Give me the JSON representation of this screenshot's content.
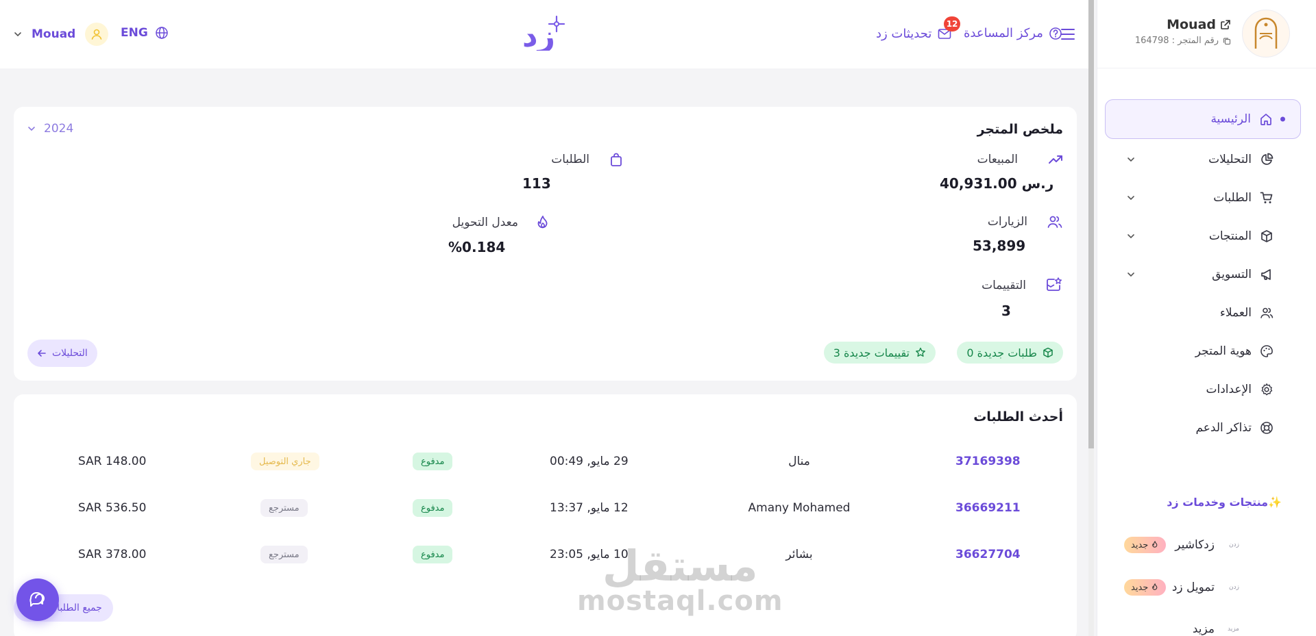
{
  "colors": {
    "accent": "#6b4bd9",
    "success": "#16864a",
    "danger": "#f04438",
    "warning": "#e5b94d"
  },
  "topbar": {
    "user_name": "Mouad",
    "language": "ENG",
    "brand_logo_text": "زد",
    "help_label": "مركز المساعدة",
    "updates_label": "تحديثات زد",
    "notification_count": "12"
  },
  "sidebar": {
    "store_name": "Mouad",
    "store_number_label": "رقم المتجر : 164798",
    "items": [
      {
        "label": "الرئيسية",
        "icon": "home-icon",
        "active": true
      },
      {
        "label": "التحليلات",
        "icon": "pie-chart-icon",
        "expandable": true
      },
      {
        "label": "الطلبات",
        "icon": "cart-icon",
        "expandable": true
      },
      {
        "label": "المنتجات",
        "icon": "box-icon",
        "expandable": true
      },
      {
        "label": "التسويق",
        "icon": "megaphone-icon",
        "expandable": true
      },
      {
        "label": "العملاء",
        "icon": "users-icon"
      },
      {
        "label": "هوية المتجر",
        "icon": "palette-icon"
      },
      {
        "label": "الإعدادات",
        "icon": "gear-icon"
      },
      {
        "label": "تذاكر الدعم",
        "icon": "lifebuoy-icon"
      }
    ],
    "section_title": "منتجات وخدمات زد✨",
    "products": [
      {
        "label": "زدكاشير",
        "mini": "زدن",
        "badge": "جديد"
      },
      {
        "label": "تمويل زد",
        "mini": "زدن",
        "badge": "جديد"
      },
      {
        "label": "مزيد",
        "mini": "مزيد"
      }
    ]
  },
  "summary": {
    "title": "ملخص المتجر",
    "year": "2024",
    "sales": {
      "label": "المبيعات",
      "value": "40,931.00 ر.س"
    },
    "orders": {
      "label": "الطلبات",
      "value": "113"
    },
    "visits": {
      "label": "الزيارات",
      "value": "53,899"
    },
    "conversion": {
      "label": "معدل التحويل",
      "value": "%0.184"
    },
    "ratings": {
      "label": "التقييمات",
      "value": "3"
    },
    "new_orders_pill": "0 طلبات جديدة",
    "new_ratings_pill": "3 تقييمات جديدة",
    "analytics_button": "التحليلات"
  },
  "latest_orders": {
    "title": "أحدث الطلبات",
    "rows": [
      {
        "id": "37169398",
        "customer": "منال",
        "date": "29 مايو, 00:49",
        "payment": "مدفوع",
        "status": "جاري التوصيل",
        "total": "SAR 148.00"
      },
      {
        "id": "36669211",
        "customer": "Amany Mohamed",
        "date": "12 مايو, 13:37",
        "payment": "مدفوع",
        "status": "مسترجع",
        "total": "SAR 536.50"
      },
      {
        "id": "36627704",
        "customer": "بشائر",
        "date": "10 مايو, 23:05",
        "payment": "مدفوع",
        "status": "مسترجع",
        "total": "SAR 378.00"
      }
    ],
    "all_orders_button": "جميع الطلبات"
  },
  "watermark": {
    "arabic": "مستقل",
    "latin": "mostaql.com"
  }
}
